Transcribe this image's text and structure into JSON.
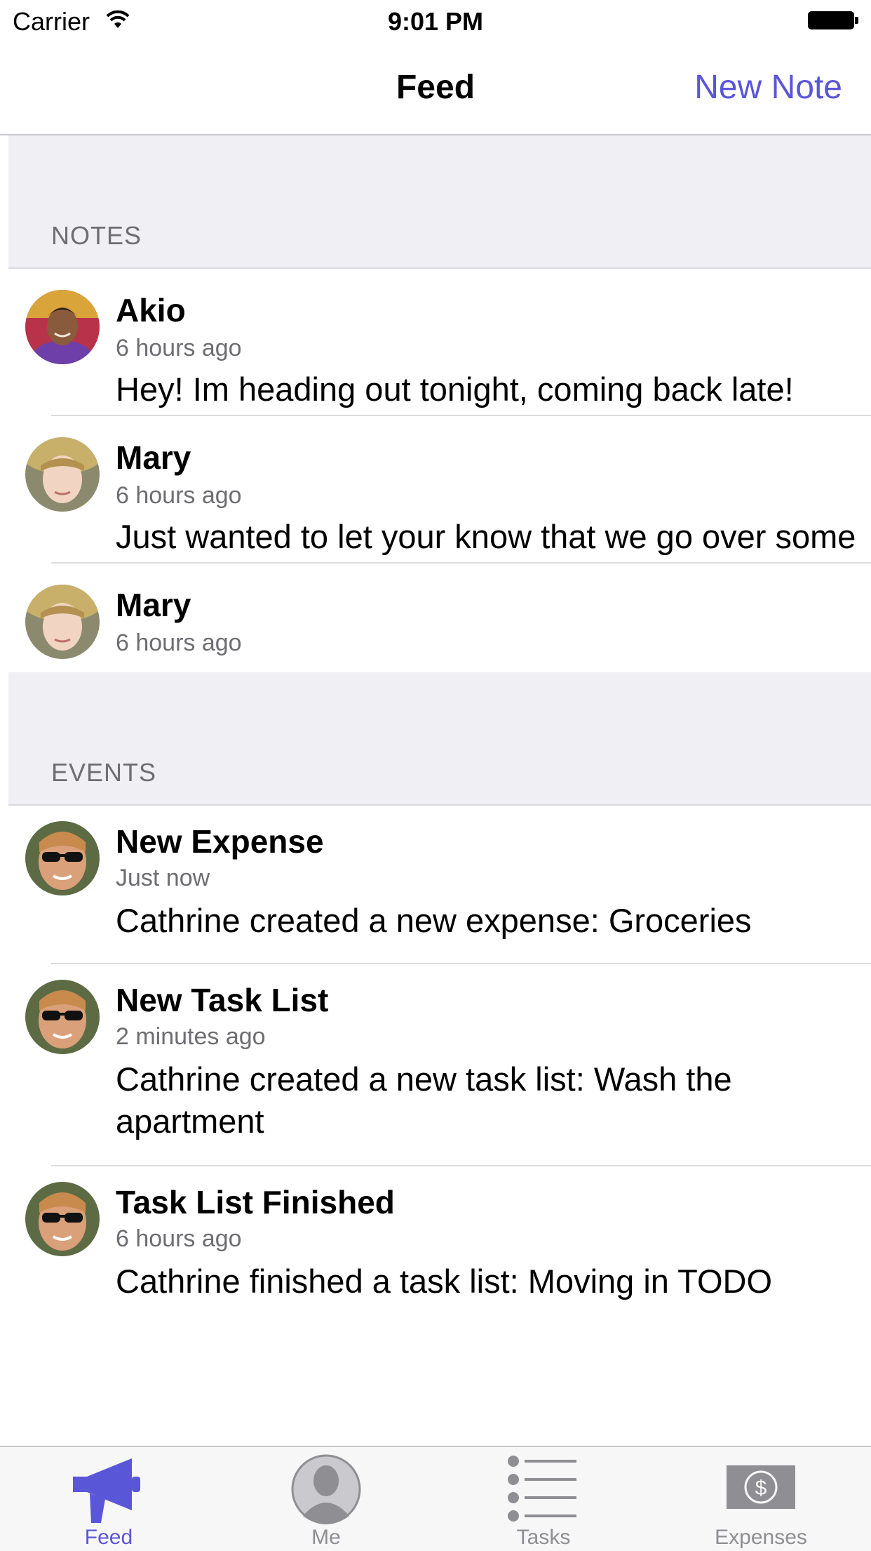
{
  "status_bar": {
    "carrier": "Carrier",
    "time": "9:01 PM"
  },
  "nav": {
    "title": "Feed",
    "right_button": "New Note"
  },
  "accent_color": "#5a56d8",
  "sections": [
    {
      "title": "NOTES",
      "items": [
        {
          "author": "Akio",
          "time": "6 hours ago",
          "text": "Hey! Im heading out tonight, coming back late!"
        },
        {
          "author": "Mary",
          "time": "6 hours ago",
          "text": "Just wanted to let your know that we go over some ground rules tonight"
        },
        {
          "author": "Mary",
          "time": "6 hours ago",
          "text": ""
        }
      ]
    },
    {
      "title": "EVENTS",
      "items": [
        {
          "title": "New Expense",
          "time": "Just now",
          "text": "Cathrine created a new expense: Groceries"
        },
        {
          "title": "New Task List",
          "time": "2 minutes ago",
          "text": "Cathrine created a new task list: Wash the apartment"
        },
        {
          "title": "Task List Finished",
          "time": "6 hours ago",
          "text": "Cathrine finished a task list: Moving in TODO"
        }
      ]
    }
  ],
  "tabs": [
    {
      "label": "Feed",
      "icon": "megaphone-icon",
      "active": true
    },
    {
      "label": "Me",
      "icon": "person-icon",
      "active": false
    },
    {
      "label": "Tasks",
      "icon": "list-icon",
      "active": false
    },
    {
      "label": "Expenses",
      "icon": "dollar-bill-icon",
      "active": false
    }
  ]
}
